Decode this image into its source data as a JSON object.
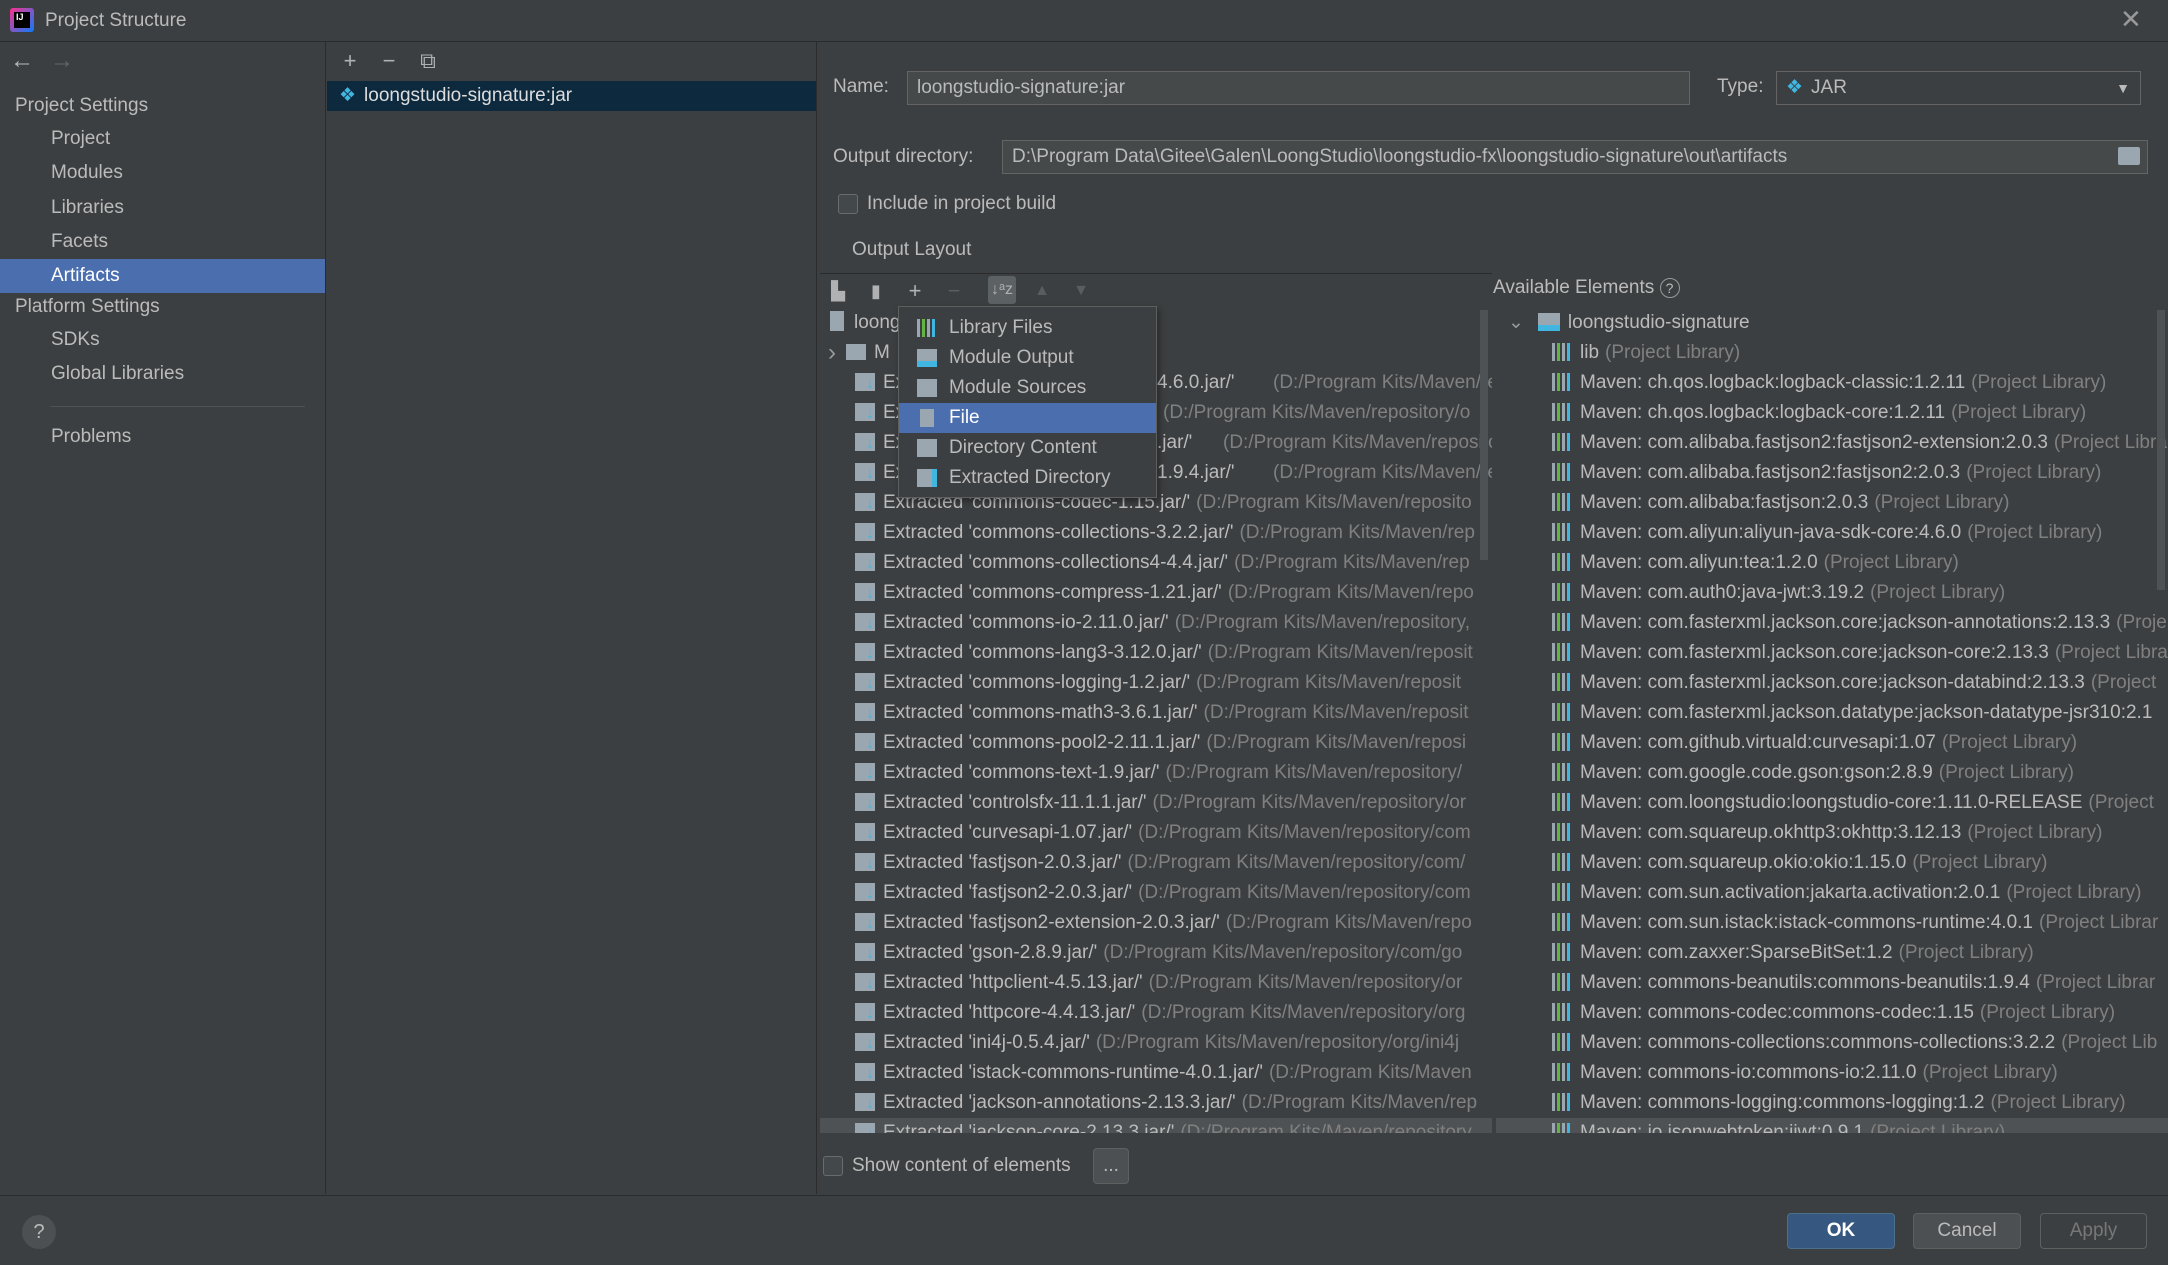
{
  "window": {
    "title": "Project Structure",
    "close_icon": "close-icon"
  },
  "nav": {
    "back": "←",
    "forward": "→"
  },
  "sidebar": {
    "project_settings": "Project Settings",
    "items": [
      {
        "label": "Project"
      },
      {
        "label": "Modules"
      },
      {
        "label": "Libraries"
      },
      {
        "label": "Facets"
      },
      {
        "label": "Artifacts",
        "selected": true
      }
    ],
    "platform_settings": "Platform Settings",
    "platform_items": [
      {
        "label": "SDKs"
      },
      {
        "label": "Global Libraries"
      }
    ],
    "problems": "Problems"
  },
  "artifacts_list": {
    "toolbar": {
      "add": "+",
      "remove": "−",
      "copy": "⧉"
    },
    "items": [
      "loongstudio-signature:jar"
    ]
  },
  "form": {
    "name_label": "Name:",
    "name_value": "loongstudio-signature:jar",
    "type_label": "Type:",
    "type_value": "JAR",
    "output_dir_label": "Output directory:",
    "output_dir_value": "D:\\Program Data\\Gitee\\Galen\\LoongStudio\\loongstudio-fx\\loongstudio-signature\\out\\artifacts",
    "include_label": "Include in project build",
    "include_checked": false,
    "output_layout_label": "Output Layout",
    "available_label": "Available Elements",
    "show_content_label": "Show content of elements",
    "show_content_checked": false,
    "ellipsis": "..."
  },
  "layout_tree": [
    {
      "name": "loong",
      "path": "",
      "icon": "jar"
    },
    {
      "name": "M",
      "path": "",
      "icon": "folder",
      "expandable": true
    },
    {
      "name": "Ex",
      "tail": "4.6.0.jar/'",
      "path": "(D:/Program Kits/Maven/rep"
    },
    {
      "name": "Ex",
      "tail": "",
      "path": "(D:/Program Kits/Maven/repository/o"
    },
    {
      "name": "Ex",
      "tail": ".jar/'",
      "path": "(D:/Program Kits/Maven/repositor"
    },
    {
      "name": "Ex",
      "tail": "1.9.4.jar/'",
      "path": "(D:/Program Kits/Maven/repo"
    },
    {
      "name": "Extracted 'commons-codec-1.15.jar/'",
      "path": "(D:/Program Kits/Maven/reposito"
    },
    {
      "name": "Extracted 'commons-collections-3.2.2.jar/'",
      "path": "(D:/Program Kits/Maven/rep"
    },
    {
      "name": "Extracted 'commons-collections4-4.4.jar/'",
      "path": "(D:/Program Kits/Maven/rep"
    },
    {
      "name": "Extracted 'commons-compress-1.21.jar/'",
      "path": "(D:/Program Kits/Maven/repo"
    },
    {
      "name": "Extracted 'commons-io-2.11.0.jar/'",
      "path": "(D:/Program Kits/Maven/repository,"
    },
    {
      "name": "Extracted 'commons-lang3-3.12.0.jar/'",
      "path": "(D:/Program Kits/Maven/reposit"
    },
    {
      "name": "Extracted 'commons-logging-1.2.jar/'",
      "path": "(D:/Program Kits/Maven/reposit"
    },
    {
      "name": "Extracted 'commons-math3-3.6.1.jar/'",
      "path": "(D:/Program Kits/Maven/reposit"
    },
    {
      "name": "Extracted 'commons-pool2-2.11.1.jar/'",
      "path": "(D:/Program Kits/Maven/reposi"
    },
    {
      "name": "Extracted 'commons-text-1.9.jar/'",
      "path": "(D:/Program Kits/Maven/repository/"
    },
    {
      "name": "Extracted 'controlsfx-11.1.1.jar/'",
      "path": "(D:/Program Kits/Maven/repository/or"
    },
    {
      "name": "Extracted 'curvesapi-1.07.jar/'",
      "path": "(D:/Program Kits/Maven/repository/com"
    },
    {
      "name": "Extracted 'fastjson-2.0.3.jar/'",
      "path": "(D:/Program Kits/Maven/repository/com/"
    },
    {
      "name": "Extracted 'fastjson2-2.0.3.jar/'",
      "path": "(D:/Program Kits/Maven/repository/com"
    },
    {
      "name": "Extracted 'fastjson2-extension-2.0.3.jar/'",
      "path": "(D:/Program Kits/Maven/repo"
    },
    {
      "name": "Extracted 'gson-2.8.9.jar/'",
      "path": "(D:/Program Kits/Maven/repository/com/go"
    },
    {
      "name": "Extracted 'httpclient-4.5.13.jar/'",
      "path": "(D:/Program Kits/Maven/repository/or"
    },
    {
      "name": "Extracted 'httpcore-4.4.13.jar/'",
      "path": "(D:/Program Kits/Maven/repository/org"
    },
    {
      "name": "Extracted 'ini4j-0.5.4.jar/'",
      "path": "(D:/Program Kits/Maven/repository/org/ini4j"
    },
    {
      "name": "Extracted 'istack-commons-runtime-4.0.1.jar/'",
      "path": "(D:/Program Kits/Maven"
    },
    {
      "name": "Extracted 'jackson-annotations-2.13.3.jar/'",
      "path": "(D:/Program Kits/Maven/rep"
    },
    {
      "name": "Extracted 'jackson-core-2.13.3.jar/'",
      "path": "(D:/Program Kits/Maven/repository"
    }
  ],
  "available_tree": {
    "root": "loongstudio-signature",
    "items": [
      {
        "name": "lib",
        "suffix": "(Project Library)"
      },
      {
        "name": "Maven: ch.qos.logback:logback-classic:1.2.11",
        "suffix": "(Project Library)"
      },
      {
        "name": "Maven: ch.qos.logback:logback-core:1.2.11",
        "suffix": "(Project Library)"
      },
      {
        "name": "Maven: com.alibaba.fastjson2:fastjson2-extension:2.0.3",
        "suffix": "(Project Libra"
      },
      {
        "name": "Maven: com.alibaba.fastjson2:fastjson2:2.0.3",
        "suffix": "(Project Library)"
      },
      {
        "name": "Maven: com.alibaba:fastjson:2.0.3",
        "suffix": "(Project Library)"
      },
      {
        "name": "Maven: com.aliyun:aliyun-java-sdk-core:4.6.0",
        "suffix": "(Project Library)"
      },
      {
        "name": "Maven: com.aliyun:tea:1.2.0",
        "suffix": "(Project Library)"
      },
      {
        "name": "Maven: com.auth0:java-jwt:3.19.2",
        "suffix": "(Project Library)"
      },
      {
        "name": "Maven: com.fasterxml.jackson.core:jackson-annotations:2.13.3",
        "suffix": "(Proje"
      },
      {
        "name": "Maven: com.fasterxml.jackson.core:jackson-core:2.13.3",
        "suffix": "(Project Libra"
      },
      {
        "name": "Maven: com.fasterxml.jackson.core:jackson-databind:2.13.3",
        "suffix": "(Project"
      },
      {
        "name": "Maven: com.fasterxml.jackson.datatype:jackson-datatype-jsr310:2.1",
        "suffix": ""
      },
      {
        "name": "Maven: com.github.virtuald:curvesapi:1.07",
        "suffix": "(Project Library)"
      },
      {
        "name": "Maven: com.google.code.gson:gson:2.8.9",
        "suffix": "(Project Library)"
      },
      {
        "name": "Maven: com.loongstudio:loongstudio-core:1.11.0-RELEASE",
        "suffix": "(Project"
      },
      {
        "name": "Maven: com.squareup.okhttp3:okhttp:3.12.13",
        "suffix": "(Project Library)"
      },
      {
        "name": "Maven: com.squareup.okio:okio:1.15.0",
        "suffix": "(Project Library)"
      },
      {
        "name": "Maven: com.sun.activation:jakarta.activation:2.0.1",
        "suffix": "(Project Library)"
      },
      {
        "name": "Maven: com.sun.istack:istack-commons-runtime:4.0.1",
        "suffix": "(Project Librar"
      },
      {
        "name": "Maven: com.zaxxer:SparseBitSet:1.2",
        "suffix": "(Project Library)"
      },
      {
        "name": "Maven: commons-beanutils:commons-beanutils:1.9.4",
        "suffix": "(Project Librar"
      },
      {
        "name": "Maven: commons-codec:commons-codec:1.15",
        "suffix": "(Project Library)"
      },
      {
        "name": "Maven: commons-collections:commons-collections:3.2.2",
        "suffix": "(Project Lib"
      },
      {
        "name": "Maven: commons-io:commons-io:2.11.0",
        "suffix": "(Project Library)"
      },
      {
        "name": "Maven: commons-logging:commons-logging:1.2",
        "suffix": "(Project Library)"
      },
      {
        "name": "Maven: io.jsonwebtoken:jjwt:0.9.1",
        "suffix": "(Project Library)"
      }
    ]
  },
  "add_menu": {
    "items": [
      {
        "label": "Library Files",
        "icon": "library-icon"
      },
      {
        "label": "Module Output",
        "icon": "module-output-icon"
      },
      {
        "label": "Module Sources",
        "icon": "module-sources-icon"
      },
      {
        "label": "File",
        "icon": "file-icon",
        "selected": true
      },
      {
        "label": "Directory Content",
        "icon": "directory-icon"
      },
      {
        "label": "Extracted Directory",
        "icon": "extracted-directory-icon"
      }
    ]
  },
  "footer": {
    "help": "?",
    "ok": "OK",
    "cancel": "Cancel",
    "apply": "Apply"
  },
  "colors": {
    "background": "#3c3f41",
    "selection": "#4b6eaf",
    "list_selection": "#0d293e",
    "ok_button": "#365880",
    "link_blue": "#40b6e0"
  }
}
